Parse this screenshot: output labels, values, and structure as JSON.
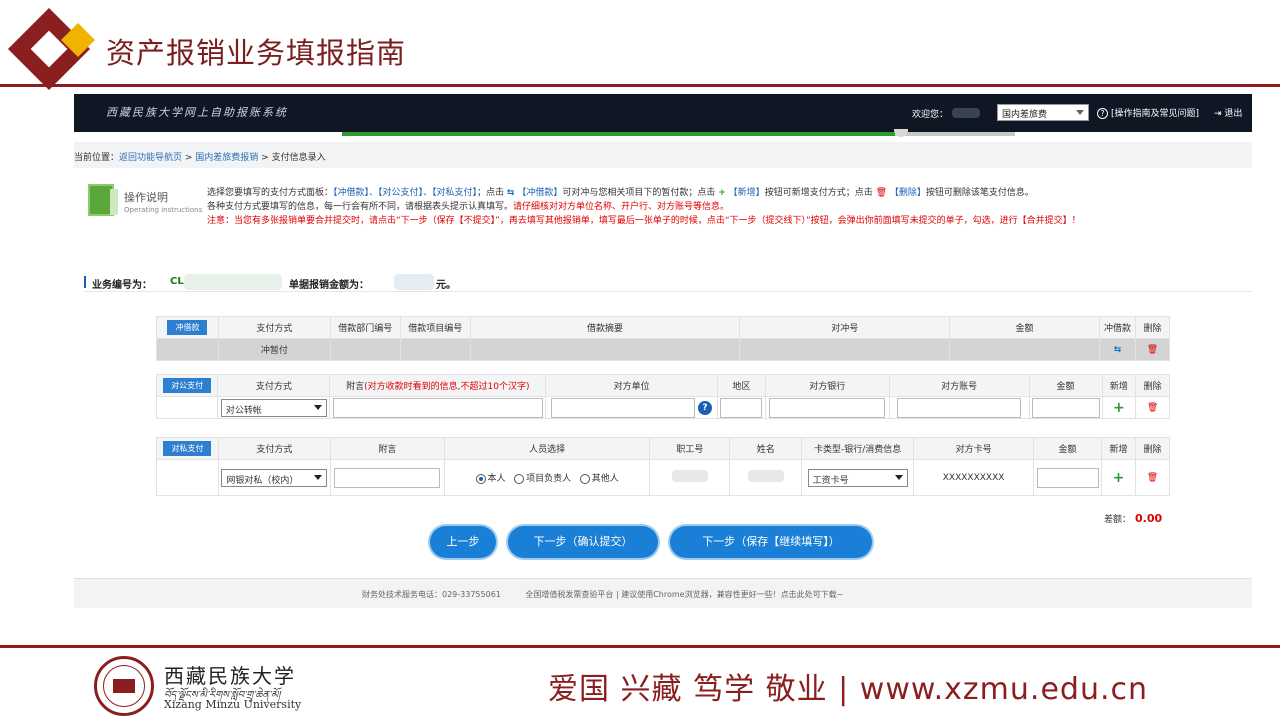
{
  "slide": {
    "title": "资产报销业务填报指南",
    "motto": "爱国  兴藏  笃学  敬业  | www.xzmu.edu.cn",
    "university_cn": "西藏民族大学",
    "university_tibetan": "བོད་ལྗོངས་མི་རིགས་སློབ་གྲྭ་ཆེན་མོ།",
    "university_en": "Xizang Minzu University"
  },
  "app": {
    "system_title": "西藏民族大学网上自助报账系统",
    "welcome": "欢迎您：",
    "category_select": "国内差旅费",
    "help_link": "[操作指南及常见问题]",
    "logout": "退出",
    "progress_fraction": 0.82
  },
  "breadcrumb": {
    "prefix": "当前位置：",
    "home": "返回功能导航页",
    "sep1": " > ",
    "section": "国内差旅费报销",
    "sep2": " > ",
    "current": "支付信息录入"
  },
  "guide": {
    "title": "操作说明",
    "subtitle": "Operating instructions",
    "line1_a": "选择您要填写的支付方式面板：",
    "line1_b": "【冲借款】、【对公支付】、【对私支付】",
    "line1_c": "；点击",
    "line1_d": "【冲借款】",
    "line1_e": "可对冲与您相关项目下的暂付款；点击",
    "line1_f": "【新增】",
    "line1_g": "按钮可新增支付方式；点击",
    "line1_h": "【删除】",
    "line1_i": "按钮可删除该笔支付信息。",
    "line2_a": "各种支付方式要填写的信息，每一行会有所不同，请根据表头提示认真填写。",
    "line2_b": "请仔细核对对方单位名称、开户行、对方账号等信息。",
    "note": "注意：当您有多张报销单要合并提交时，请点击“下一步（保存【不提交】”，再去填写其他报销单，填写最后一张单子的时候，点击“下一步（提交线下）”按钮，会弹出你前面填写未提交的单子，勾选，进行【合并提交】！"
  },
  "business": {
    "number_label": "业务编号为：",
    "number_prefix": "CL",
    "amount_label": "单据报销金额为：",
    "amount_unit": "元。"
  },
  "loan_table": {
    "tag": "冲借款",
    "headers": [
      "支付方式",
      "借款部门编号",
      "借款项目编号",
      "借款摘要",
      "对冲号",
      "金额",
      "冲借款",
      "删除"
    ],
    "row_method": "冲暂付"
  },
  "public_table": {
    "tag": "对公支付",
    "headers": [
      "支付方式",
      "附言",
      "对方单位",
      "地区",
      "对方银行",
      "对方账号",
      "金额",
      "新增",
      "删除"
    ],
    "memo_hint": "(对方收款时看到的信息,不超过10个汉字)",
    "method_value": "对公转帐"
  },
  "private_table": {
    "tag": "对私支付",
    "headers": [
      "支付方式",
      "附言",
      "人员选择",
      "职工号",
      "姓名",
      "卡类型-银行/消费信息",
      "对方卡号",
      "金额",
      "新增",
      "删除"
    ],
    "method_value": "网银对私（校内）",
    "radio_self": "本人",
    "radio_leader": "项目负责人",
    "radio_other": "其他人",
    "card_type_value": "工资卡号",
    "card_number_mask": "XXXXXXXXXX"
  },
  "summary": {
    "diff_label": "差额：",
    "diff_value": "0.00"
  },
  "buttons": {
    "prev": "上一步",
    "next_submit": "下一步（确认提交）",
    "next_save": "下一步（保存【继续填写】）"
  },
  "footer": {
    "phone": "财务处技术服务电话：029-33755061",
    "invoice": "全国增值税发票查验平台",
    "sep": "  |  ",
    "browser": "建议使用Chrome浏览器，兼容性更好一些！点击此处可下载~"
  },
  "colors": {
    "brand_red": "#8b1f1f",
    "brand_gold": "#f0b400",
    "accent_blue": "#1a7fd6",
    "ok_green": "#2e9b2e",
    "alert_red": "#e00000"
  }
}
